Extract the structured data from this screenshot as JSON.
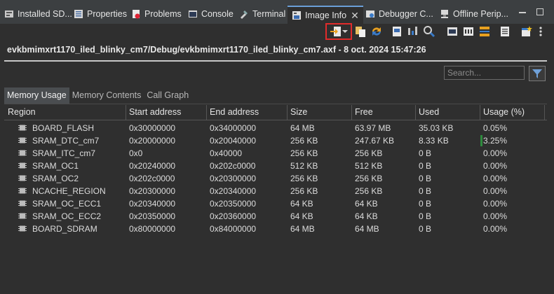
{
  "tabs": [
    {
      "label": "Installed SD...",
      "icon": "installed-sdk-icon"
    },
    {
      "label": "Properties",
      "icon": "properties-icon"
    },
    {
      "label": "Problems",
      "icon": "problems-icon"
    },
    {
      "label": "Console",
      "icon": "console-icon"
    },
    {
      "label": "Terminal",
      "icon": "terminal-icon"
    },
    {
      "label": "Image Info",
      "icon": "image-info-icon",
      "active": true
    },
    {
      "label": "Debugger C...",
      "icon": "debugger-icon"
    },
    {
      "label": "Offline Perip...",
      "icon": "offline-peripherals-icon"
    }
  ],
  "file_info": "evkbmimxrt1170_iled_blinky_cm7/Debug/evkbmimxrt1170_iled_blinky_cm7.axf - 8 oct. 2024 15:47:26",
  "search": {
    "placeholder": "Search..."
  },
  "inner_tabs": [
    "Memory Usage",
    "Memory Contents",
    "Call Graph"
  ],
  "columns": [
    "Region",
    "Start address",
    "End address",
    "Size",
    "Free",
    "Used",
    "Usage (%)"
  ],
  "rows": [
    {
      "region": "BOARD_FLASH",
      "start": "0x30000000",
      "end": "0x34000000",
      "size": "64 MB",
      "free": "63.97 MB",
      "used": "35.03 KB",
      "usage": "0.05%",
      "usage_fraction": 0.0005
    },
    {
      "region": "SRAM_DTC_cm7",
      "start": "0x20000000",
      "end": "0x20040000",
      "size": "256 KB",
      "free": "247.67 KB",
      "used": "8.33 KB",
      "usage": "3.25%",
      "usage_fraction": 0.0325
    },
    {
      "region": "SRAM_ITC_cm7",
      "start": "0x0",
      "end": "0x40000",
      "size": "256 KB",
      "free": "256 KB",
      "used": "0 B",
      "usage": "0.00%",
      "usage_fraction": 0
    },
    {
      "region": "SRAM_OC1",
      "start": "0x20240000",
      "end": "0x202c0000",
      "size": "512 KB",
      "free": "512 KB",
      "used": "0 B",
      "usage": "0.00%",
      "usage_fraction": 0
    },
    {
      "region": "SRAM_OC2",
      "start": "0x202c0000",
      "end": "0x20300000",
      "size": "256 KB",
      "free": "256 KB",
      "used": "0 B",
      "usage": "0.00%",
      "usage_fraction": 0
    },
    {
      "region": "NCACHE_REGION",
      "start": "0x20300000",
      "end": "0x20340000",
      "size": "256 KB",
      "free": "256 KB",
      "used": "0 B",
      "usage": "0.00%",
      "usage_fraction": 0
    },
    {
      "region": "SRAM_OC_ECC1",
      "start": "0x20340000",
      "end": "0x20350000",
      "size": "64 KB",
      "free": "64 KB",
      "used": "0 B",
      "usage": "0.00%",
      "usage_fraction": 0
    },
    {
      "region": "SRAM_OC_ECC2",
      "start": "0x20350000",
      "end": "0x20360000",
      "size": "64 KB",
      "free": "64 KB",
      "used": "0 B",
      "usage": "0.00%",
      "usage_fraction": 0
    },
    {
      "region": "BOARD_SDRAM",
      "start": "0x80000000",
      "end": "0x84000000",
      "size": "64 MB",
      "free": "64 MB",
      "used": "0 B",
      "usage": "0.00%",
      "usage_fraction": 0
    }
  ],
  "colors": {
    "highlight": "#e02b2b",
    "usage_bar": "#2e8b3e",
    "active_tab_accent": "#6a9fd8"
  }
}
